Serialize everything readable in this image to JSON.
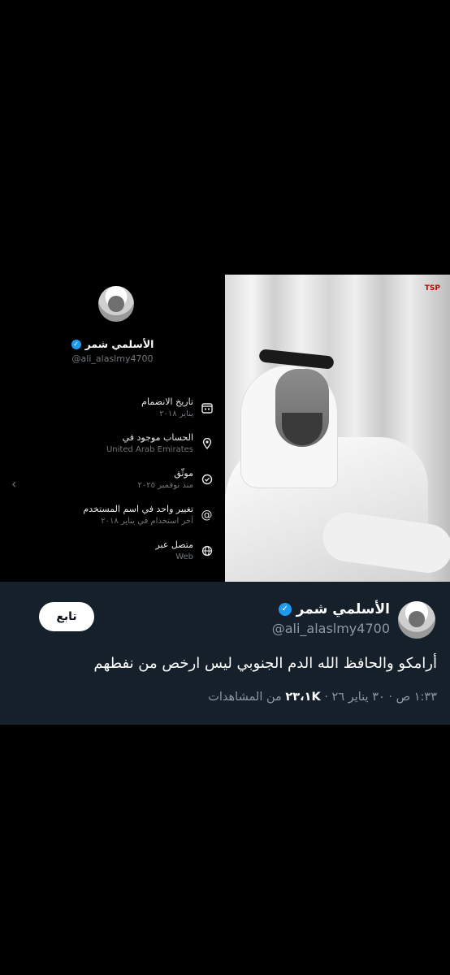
{
  "about": {
    "name": "الأسلمي شمر",
    "handle": "@ali_alaslmy4700",
    "rows": [
      {
        "title": "تاريخ الانضمام",
        "sub": "يناير ٢٠١٨",
        "icon": "calendar-icon"
      },
      {
        "title": "الحساب موجود في",
        "sub": "United Arab Emirates",
        "icon": "location-pin-icon"
      },
      {
        "title": "موثّق",
        "sub": "منذ نوفمبر ٢٠٢٥",
        "icon": "verified-check-icon"
      },
      {
        "title": "تغيير واحد في اسم المستخدم",
        "sub": "آخر استخدام في يناير ٢٠١٨",
        "icon": "at-sign-icon"
      },
      {
        "title": "متصل عبر",
        "sub": "Web",
        "icon": "globe-icon"
      }
    ],
    "chevron": "‹"
  },
  "photo": {
    "logo": "TSP"
  },
  "tweet": {
    "name": "الأسلمي شمر",
    "handle": "@ali_alaslmy4700",
    "follow_label": "تابع",
    "text": "أرامكو والحافظ الله الدم الجنوبي ليس ارخص من نفطهم",
    "time_date": "١:٣٣ ص · ٣٠ يناير ٢٦ ·",
    "views_count": "٢٣،١K",
    "views_label": "من المشاهدات"
  },
  "colors": {
    "tweet_bg": "#15202b",
    "verified_blue": "#1d9bf0",
    "muted": "#71767b"
  }
}
